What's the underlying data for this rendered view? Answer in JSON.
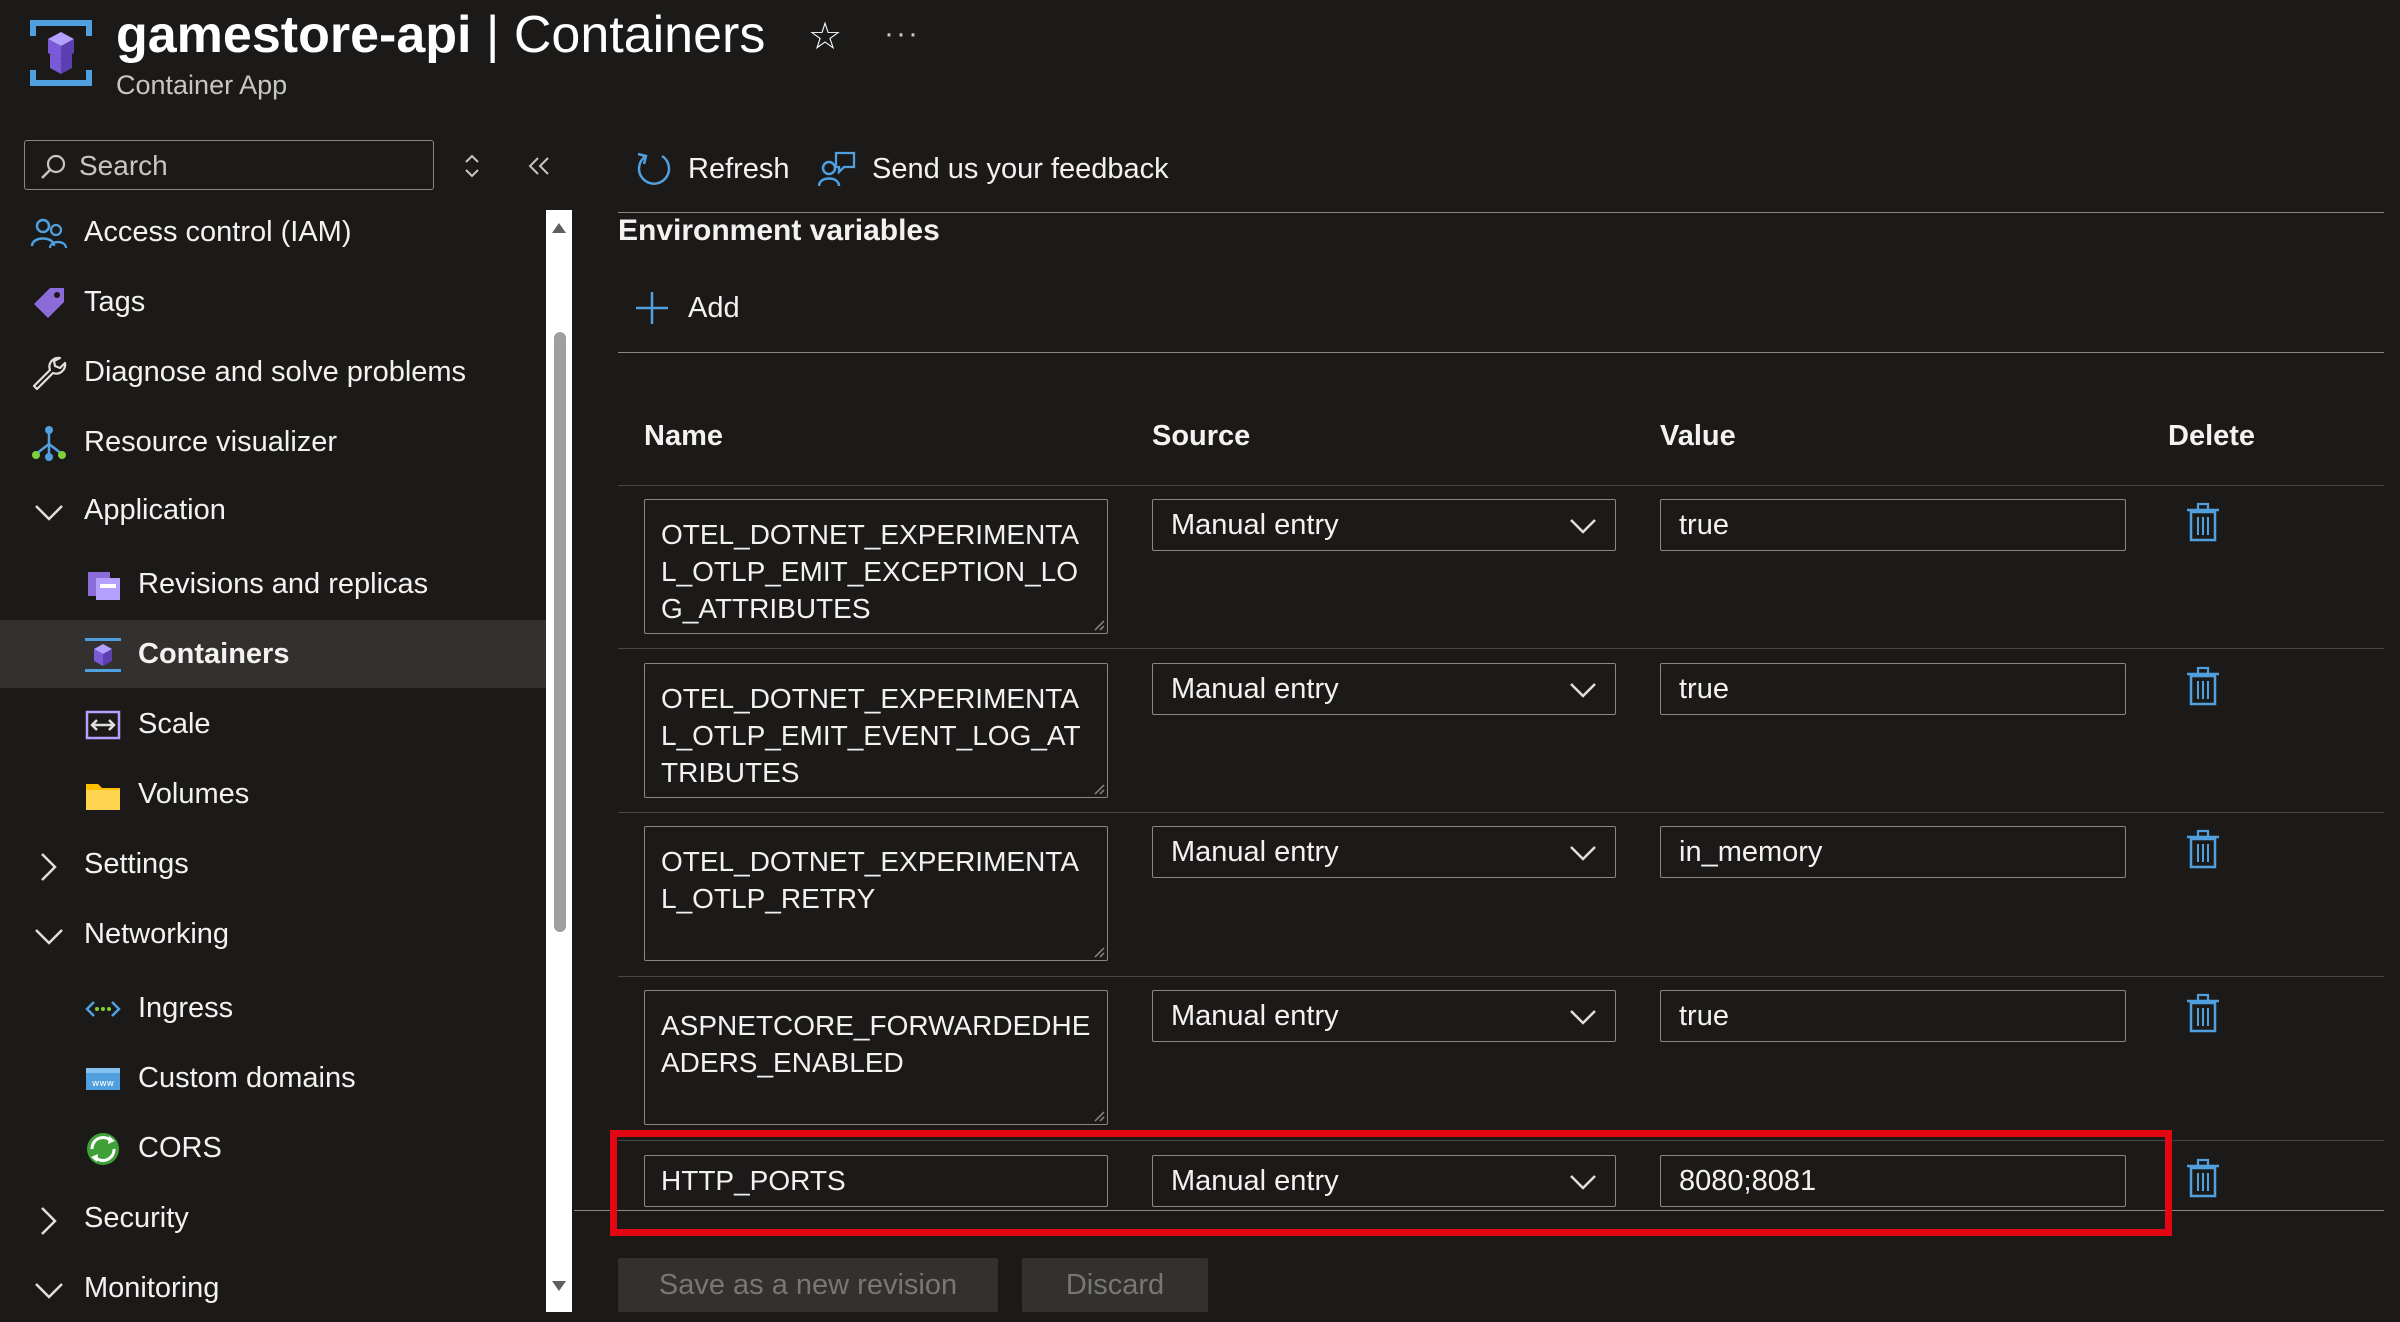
{
  "header": {
    "resource_name": "gamestore-api",
    "separator": " | ",
    "page_name": "Containers",
    "subtitle": "Container App",
    "favorite_icon": "star-icon",
    "more_icon": "ellipsis-icon"
  },
  "search": {
    "placeholder": "Search"
  },
  "sidebar": {
    "items": [
      {
        "label": "Access control (IAM)",
        "icon": "people-icon",
        "level": 0
      },
      {
        "label": "Tags",
        "icon": "tag-icon",
        "level": 0
      },
      {
        "label": "Diagnose and solve problems",
        "icon": "wrench-icon",
        "level": 0
      },
      {
        "label": "Resource visualizer",
        "icon": "hierarchy-icon",
        "level": 0
      },
      {
        "label": "Application",
        "icon": "chevron-down-icon",
        "level": 0,
        "expanded": true
      },
      {
        "label": "Revisions and replicas",
        "icon": "revisions-icon",
        "level": 1
      },
      {
        "label": "Containers",
        "icon": "containers-icon",
        "level": 1,
        "selected": true
      },
      {
        "label": "Scale",
        "icon": "scale-icon",
        "level": 1
      },
      {
        "label": "Volumes",
        "icon": "folder-icon",
        "level": 1
      },
      {
        "label": "Settings",
        "icon": "chevron-right-icon",
        "level": 0,
        "expanded": false
      },
      {
        "label": "Networking",
        "icon": "chevron-down-icon",
        "level": 0,
        "expanded": true
      },
      {
        "label": "Ingress",
        "icon": "ingress-icon",
        "level": 1
      },
      {
        "label": "Custom domains",
        "icon": "www-icon",
        "level": 1
      },
      {
        "label": "CORS",
        "icon": "cors-icon",
        "level": 1
      },
      {
        "label": "Security",
        "icon": "chevron-right-icon",
        "level": 0,
        "expanded": false
      },
      {
        "label": "Monitoring",
        "icon": "chevron-down-icon",
        "level": 0,
        "expanded": true
      }
    ]
  },
  "toolbar": {
    "refresh_label": "Refresh",
    "feedback_label": "Send us your feedback"
  },
  "section": {
    "title": "Environment variables",
    "add_label": "Add"
  },
  "table": {
    "columns": {
      "name": "Name",
      "source": "Source",
      "value": "Value",
      "delete": "Delete"
    },
    "rows": [
      {
        "name": "OTEL_DOTNET_EXPERIMENTAL_OTLP_EMIT_EXCEPTION_LOG_ATTRIBUTES",
        "source": "Manual entry",
        "value": "true"
      },
      {
        "name": "OTEL_DOTNET_EXPERIMENTAL_OTLP_EMIT_EVENT_LOG_ATTRIBUTES",
        "source": "Manual entry",
        "value": "true"
      },
      {
        "name": "OTEL_DOTNET_EXPERIMENTAL_OTLP_RETRY",
        "source": "Manual entry",
        "value": "in_memory"
      },
      {
        "name": "ASPNETCORE_FORWARDEDHEADERS_ENABLED",
        "source": "Manual entry",
        "value": "true"
      },
      {
        "name": "HTTP_PORTS",
        "source": "Manual entry",
        "value": "8080;8081",
        "highlighted": true
      }
    ]
  },
  "footer": {
    "save_label": "Save as a new revision",
    "discard_label": "Discard"
  },
  "colors": {
    "accent": "#0078d4",
    "highlight": "#e30613",
    "background": "#1b1a19",
    "selected": "#323130"
  }
}
